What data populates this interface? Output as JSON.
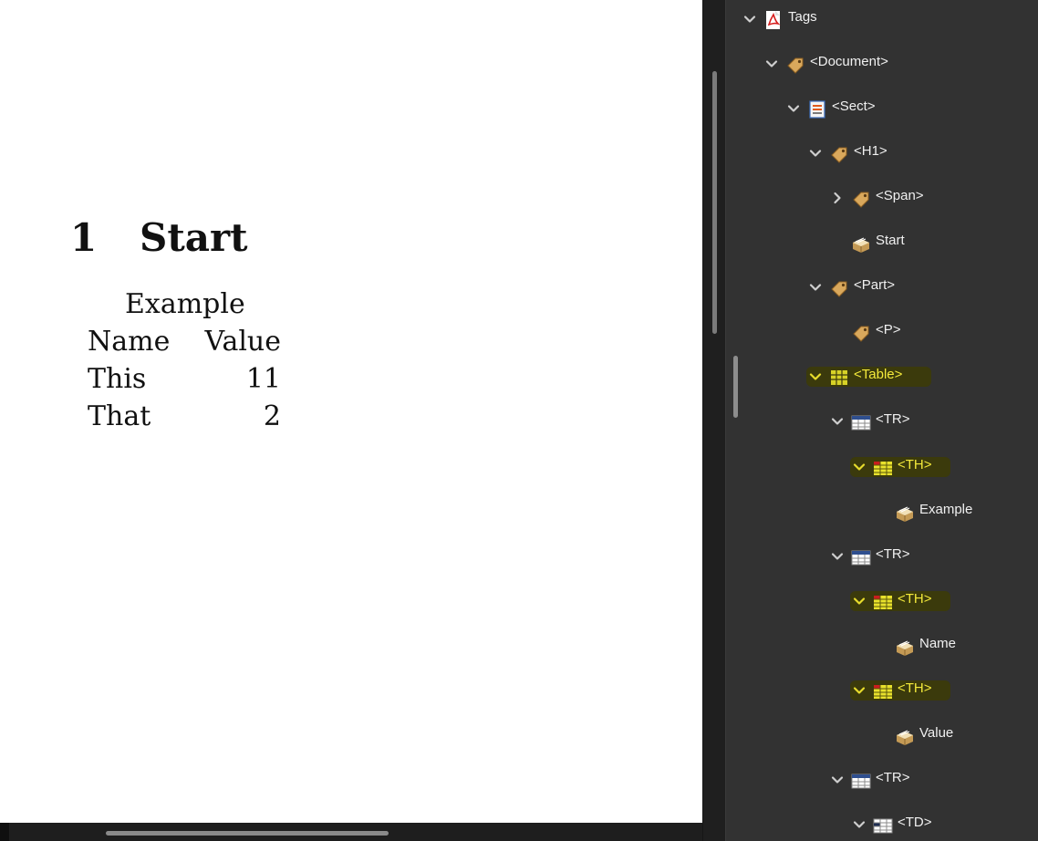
{
  "document": {
    "heading_number": "1",
    "heading_title": "Start",
    "table": {
      "caption": "Example",
      "headers": [
        "Name",
        "Value"
      ],
      "rows": [
        [
          "This",
          "11"
        ],
        [
          "That",
          "2"
        ]
      ]
    }
  },
  "tags_panel": {
    "nodes": [
      {
        "label": "Tags",
        "icon": "pdf-icon",
        "expanded": true
      },
      {
        "label": "<Document>",
        "icon": "tag-icon",
        "expanded": true
      },
      {
        "label": "<Sect>",
        "icon": "section-icon",
        "expanded": true
      },
      {
        "label": "<H1>",
        "icon": "tag-icon",
        "expanded": true
      },
      {
        "label": "<Span>",
        "icon": "tag-icon",
        "expanded": false
      },
      {
        "label": "Start",
        "icon": "content-icon"
      },
      {
        "label": "<Part>",
        "icon": "tag-icon",
        "expanded": true
      },
      {
        "label": "<P>",
        "icon": "tag-icon"
      },
      {
        "label": "<Table>",
        "icon": "table-icon",
        "expanded": true,
        "highlighted": true
      },
      {
        "label": "<TR>",
        "icon": "table-row-icon",
        "expanded": true
      },
      {
        "label": "<TH>",
        "icon": "table-header-icon",
        "expanded": true,
        "highlighted": true
      },
      {
        "label": "Example",
        "icon": "content-icon"
      },
      {
        "label": "<TR>",
        "icon": "table-row-icon",
        "expanded": true
      },
      {
        "label": "<TH>",
        "icon": "table-header-icon",
        "expanded": true,
        "highlighted": true
      },
      {
        "label": "Name",
        "icon": "content-icon"
      },
      {
        "label": "<TH>",
        "icon": "table-header-icon",
        "expanded": true,
        "highlighted": true
      },
      {
        "label": "Value",
        "icon": "content-icon"
      },
      {
        "label": "<TR>",
        "icon": "table-row-icon",
        "expanded": true
      },
      {
        "label": "<TD>",
        "icon": "table-cell-icon",
        "expanded": true
      }
    ]
  },
  "colors": {
    "highlight_text": "#f4ea3b",
    "highlight_bg": "#3b3a0c",
    "panel_bg": "#323232"
  }
}
